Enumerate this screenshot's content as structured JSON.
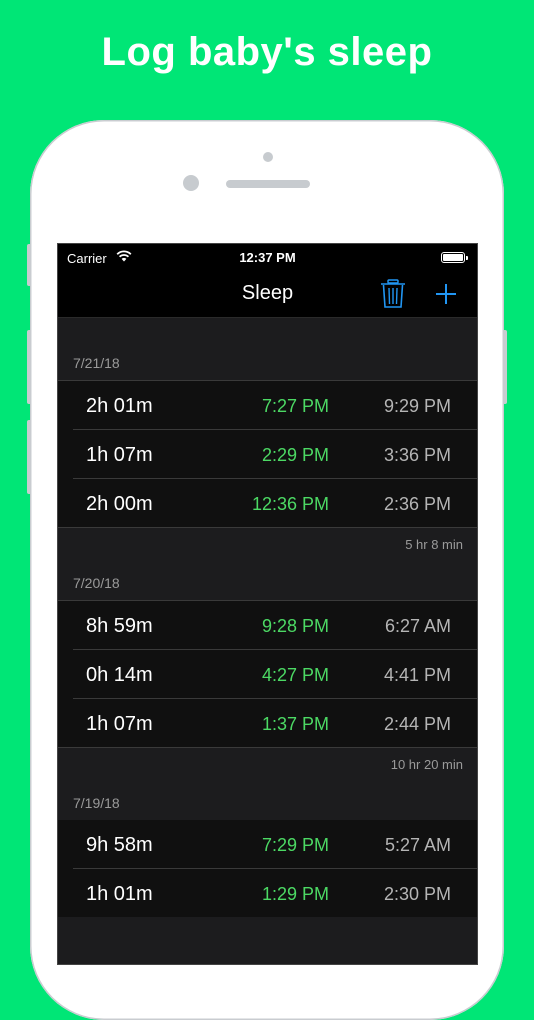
{
  "headline": "Log baby's sleep",
  "status": {
    "carrier": "Carrier",
    "time": "12:37 PM"
  },
  "nav": {
    "title": "Sleep"
  },
  "sections": [
    {
      "date": "7/21/18",
      "total": "5 hr 8 min",
      "rows": [
        {
          "duration": "2h 01m",
          "start": "7:27 PM",
          "end": "9:29 PM"
        },
        {
          "duration": "1h 07m",
          "start": "2:29 PM",
          "end": "3:36 PM"
        },
        {
          "duration": "2h 00m",
          "start": "12:36 PM",
          "end": "2:36 PM"
        }
      ]
    },
    {
      "date": "7/20/18",
      "total": "10 hr 20 min",
      "rows": [
        {
          "duration": "8h 59m",
          "start": "9:28 PM",
          "end": "6:27 AM"
        },
        {
          "duration": "0h 14m",
          "start": "4:27 PM",
          "end": "4:41 PM"
        },
        {
          "duration": "1h 07m",
          "start": "1:37 PM",
          "end": "2:44 PM"
        }
      ]
    },
    {
      "date": "7/19/18",
      "total": "",
      "rows": [
        {
          "duration": "9h 58m",
          "start": "7:29 PM",
          "end": "5:27 AM"
        },
        {
          "duration": "1h 01m",
          "start": "1:29 PM",
          "end": "2:30 PM"
        }
      ]
    }
  ],
  "colors": {
    "background": "#00e676",
    "start_time": "#4cd964",
    "accent": "#2196f3"
  },
  "icons": {
    "trash": "trash-icon",
    "add": "plus-icon",
    "wifi": "wifi-icon",
    "battery": "battery-icon"
  }
}
